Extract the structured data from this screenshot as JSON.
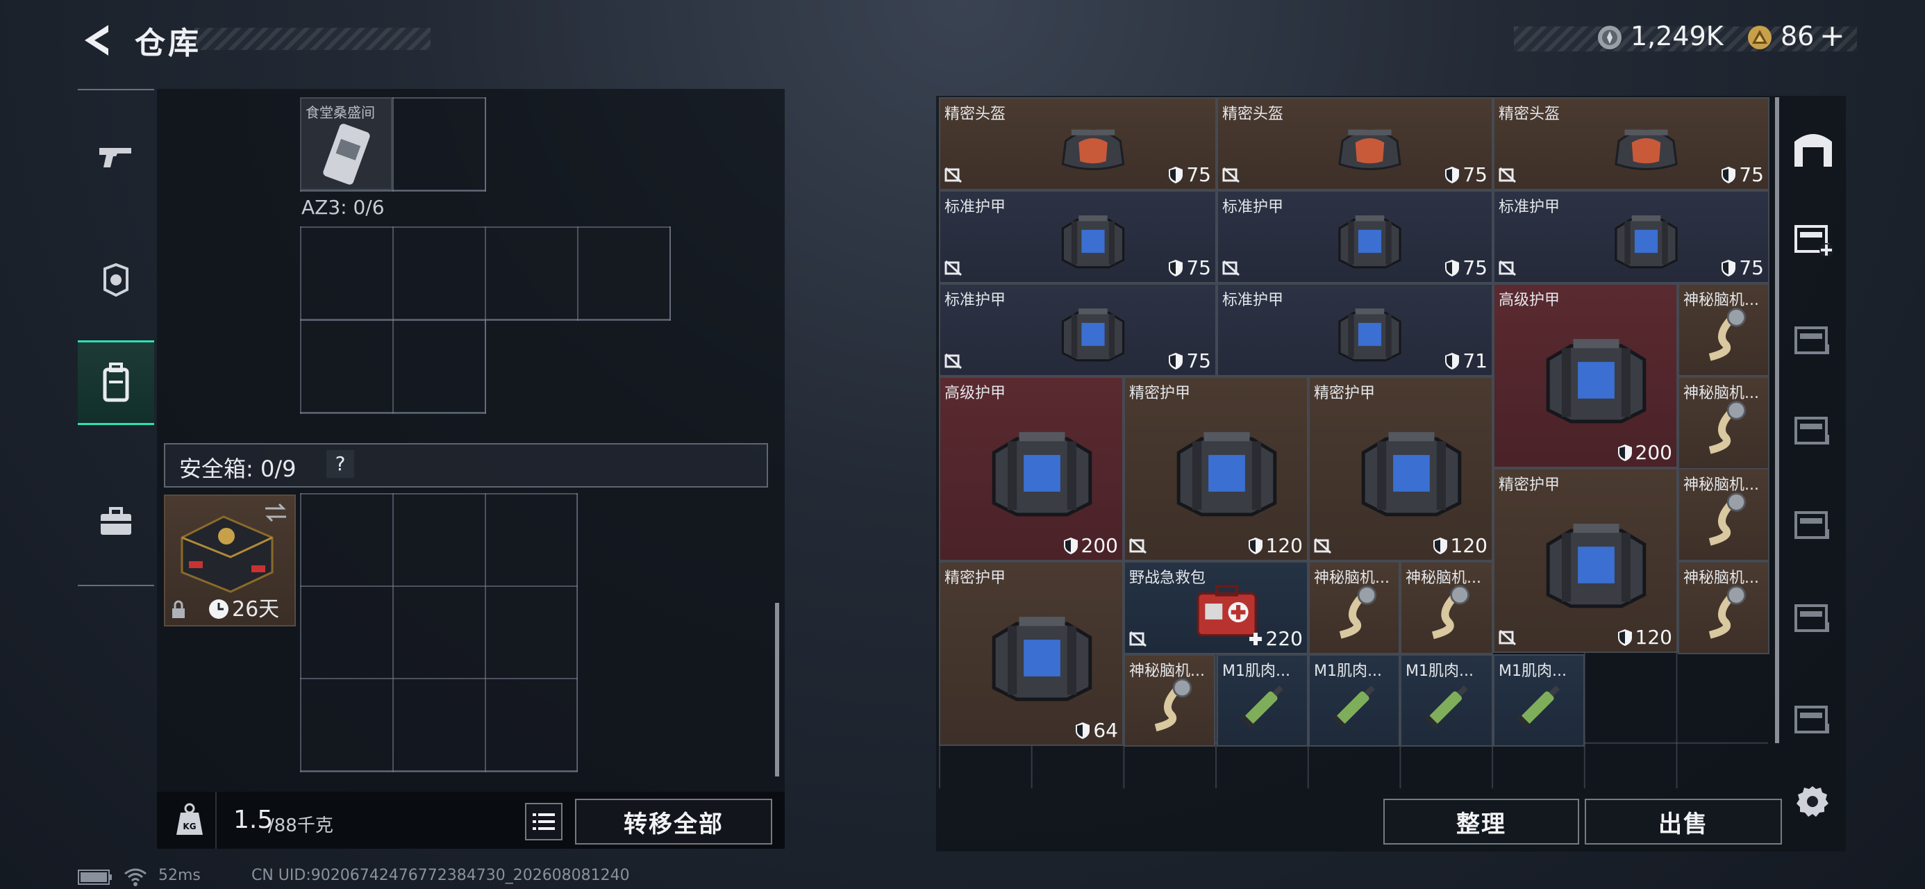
{
  "header": {
    "title": "仓库"
  },
  "currency": {
    "coins": "1,249K",
    "premium": "86",
    "premium_plus": "+"
  },
  "left_nav": [
    {
      "icon": "pistol-icon"
    },
    {
      "icon": "helmet-badge-icon"
    },
    {
      "icon": "backpack-icon",
      "active": true
    },
    {
      "icon": "briefcase-icon"
    }
  ],
  "container": {
    "top_item_label": "食堂桑盛间",
    "az3_label": "AZ3: 0/6",
    "safe_box_label": "安全箱: 0/9",
    "safe_box_help": "?",
    "safe_item_days": "26天"
  },
  "weight": {
    "current": "1.5",
    "max": "/88千克",
    "kg_icon_text": "KG"
  },
  "buttons": {
    "transfer_all": "转移全部",
    "organize": "整理",
    "sell": "出售"
  },
  "stash_items": [
    {
      "name": "精密头盔",
      "durability": "75",
      "kind": "helmet",
      "color": "brown",
      "locked": true
    },
    {
      "name": "精密头盔",
      "durability": "75",
      "kind": "helmet",
      "color": "brown",
      "locked": true
    },
    {
      "name": "精密头盔",
      "durability": "75",
      "kind": "helmet",
      "color": "brown",
      "locked": true
    },
    {
      "name": "标准护甲",
      "durability": "75",
      "kind": "armor",
      "color": "navy",
      "locked": true
    },
    {
      "name": "标准护甲",
      "durability": "75",
      "kind": "armor",
      "color": "navy",
      "locked": true
    },
    {
      "name": "标准护甲",
      "durability": "75",
      "kind": "armor",
      "color": "navy",
      "locked": true
    },
    {
      "name": "标准护甲",
      "durability": "75",
      "kind": "armor",
      "color": "navy",
      "locked": true
    },
    {
      "name": "标准护甲",
      "durability": "71",
      "kind": "armor",
      "color": "navy",
      "locked": false
    },
    {
      "name": "高级护甲",
      "durability": "200",
      "kind": "armor",
      "color": "red",
      "locked": false
    },
    {
      "name": "神秘脑机...",
      "durability": "",
      "kind": "cable",
      "color": "brown",
      "locked": false
    },
    {
      "name": "高级护甲",
      "durability": "200",
      "kind": "armor",
      "color": "red",
      "locked": false
    },
    {
      "name": "精密护甲",
      "durability": "120",
      "kind": "armor",
      "color": "brown",
      "locked": true
    },
    {
      "name": "精密护甲",
      "durability": "120",
      "kind": "armor",
      "color": "brown",
      "locked": true
    },
    {
      "name": "神秘脑机...",
      "durability": "",
      "kind": "cable",
      "color": "brown",
      "locked": false
    },
    {
      "name": "精密护甲",
      "durability": "120",
      "kind": "armor",
      "color": "brown",
      "locked": true
    },
    {
      "name": "神秘脑机...",
      "durability": "",
      "kind": "cable",
      "color": "brown",
      "locked": false
    },
    {
      "name": "精密护甲",
      "durability": "64",
      "kind": "armor",
      "color": "brown",
      "locked": false
    },
    {
      "name": "野战急救包",
      "durability": "220",
      "kind": "medkit",
      "color": "blue",
      "locked": true
    },
    {
      "name": "神秘脑机...",
      "durability": "",
      "kind": "cable",
      "color": "brown",
      "locked": false
    },
    {
      "name": "神秘脑机...",
      "durability": "",
      "kind": "cable",
      "color": "brown",
      "locked": false
    },
    {
      "name": "神秘脑机...",
      "durability": "",
      "kind": "cable",
      "color": "brown",
      "locked": false
    },
    {
      "name": "神秘脑机...",
      "durability": "",
      "kind": "cable",
      "color": "brown",
      "locked": false
    },
    {
      "name": "M1肌肉...",
      "durability": "",
      "kind": "syringe",
      "color": "blue",
      "locked": false
    },
    {
      "name": "M1肌肉...",
      "durability": "",
      "kind": "syringe",
      "color": "blue",
      "locked": false
    },
    {
      "name": "M1肌肉...",
      "durability": "",
      "kind": "syringe",
      "color": "blue",
      "locked": false
    },
    {
      "name": "M1肌肉...",
      "durability": "",
      "kind": "syringe",
      "color": "blue",
      "locked": false
    }
  ],
  "right_nav": [
    {
      "icon": "storage-home-icon"
    },
    {
      "icon": "add-storage-iv-icon"
    },
    {
      "icon": "storage-iv-icon"
    },
    {
      "icon": "storage-iv-icon"
    },
    {
      "icon": "storage-v-icon"
    },
    {
      "icon": "storage-v-icon"
    },
    {
      "icon": "storage-iv-icon"
    }
  ],
  "status_bar": {
    "ping": "52ms",
    "uid": "CN UID:90206742476772384730_202608081240"
  }
}
